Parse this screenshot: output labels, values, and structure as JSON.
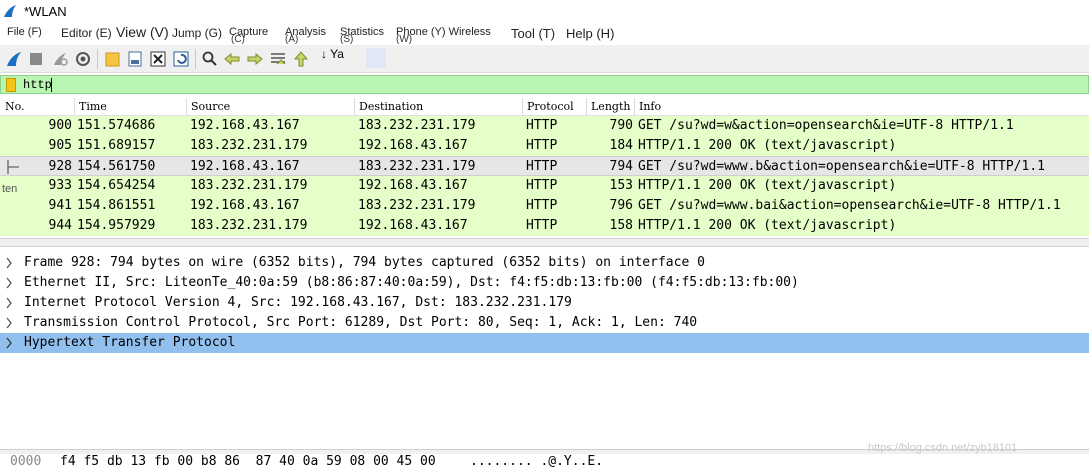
{
  "window": {
    "title": "*WLAN"
  },
  "menu": {
    "file": "File (F)",
    "edit": "Editor (E)",
    "view": "View (V)",
    "jump": "Jump (G)",
    "capture": "Capture",
    "capture_key": "(C)",
    "analysis": "Analysis",
    "analysis_key": "(A)",
    "statistics": "Statistics",
    "statistics_key": "(S)",
    "phone": "Phone (Y) Wireless",
    "phone_key": "(W)",
    "tools": "Tool (T)",
    "help": "Help (H)"
  },
  "toolbar": {
    "overflow_label": "↓ Ya",
    "icons": [
      "shark-fin-start-icon",
      "stop-square-icon",
      "restart-icon",
      "capture-options-gear-icon",
      "open-folder-icon",
      "save-file-icon",
      "close-file-icon",
      "reload-file-icon",
      "find-packet-icon",
      "go-back-icon",
      "go-forward-icon",
      "go-to-packet-icon",
      "go-first-icon"
    ]
  },
  "filter": {
    "value": "http"
  },
  "columns": {
    "no": "No.",
    "time": "Time",
    "source": "Source",
    "destination": "Destination",
    "protocol": "Protocol",
    "length": "Length",
    "info": "Info"
  },
  "packets": [
    {
      "no": "900",
      "time": "151.574686",
      "source": "192.168.43.167",
      "destination": "183.232.231.179",
      "protocol": "HTTP",
      "length": "790",
      "info": "GET /su?wd=w&action=opensearch&ie=UTF-8 HTTP/1.1"
    },
    {
      "no": "905",
      "time": "151.689157",
      "source": "183.232.231.179",
      "destination": "192.168.43.167",
      "protocol": "HTTP",
      "length": "184",
      "info": "HTTP/1.1 200 OK  (text/javascript)"
    },
    {
      "no": "928",
      "time": "154.561750",
      "source": "192.168.43.167",
      "destination": "183.232.231.179",
      "protocol": "HTTP",
      "length": "794",
      "info": "GET /su?wd=www.b&action=opensearch&ie=UTF-8 HTTP/1.1"
    },
    {
      "no": "933",
      "time": "154.654254",
      "source": "183.232.231.179",
      "destination": "192.168.43.167",
      "protocol": "HTTP",
      "length": "153",
      "info": "HTTP/1.1 200 OK  (text/javascript)"
    },
    {
      "no": "941",
      "time": "154.861551",
      "source": "192.168.43.167",
      "destination": "183.232.231.179",
      "protocol": "HTTP",
      "length": "796",
      "info": "GET /su?wd=www.bai&action=opensearch&ie=UTF-8 HTTP/1.1"
    },
    {
      "no": "944",
      "time": "154.957929",
      "source": "183.232.231.179",
      "destination": "192.168.43.167",
      "protocol": "HTTP",
      "length": "158",
      "info": "HTTP/1.1 200 OK  (text/javascript)"
    }
  ],
  "selected_packet_no": "928",
  "side_label": "ten",
  "details": [
    "Frame 928: 794 bytes on wire (6352 bits), 794 bytes captured (6352 bits) on interface 0",
    "Ethernet II, Src: LiteonTe_40:0a:59 (b8:86:87:40:0a:59), Dst: f4:f5:db:13:fb:00 (f4:f5:db:13:fb:00)",
    "Internet Protocol Version 4, Src: 192.168.43.167, Dst: 183.232.231.179",
    "Transmission Control Protocol, Src Port: 61289, Dst Port: 80, Seq: 1, Ack: 1, Len: 740",
    "Hypertext Transfer Protocol"
  ],
  "hex": {
    "offset": "0000",
    "bytes": "f4 f5 db 13 fb 00 b8 86  87 40 0a 59 08 00 45 00",
    "ascii": "........ .@.Y..E."
  },
  "watermark": "https://blog.csdn.net/zyb18101"
}
